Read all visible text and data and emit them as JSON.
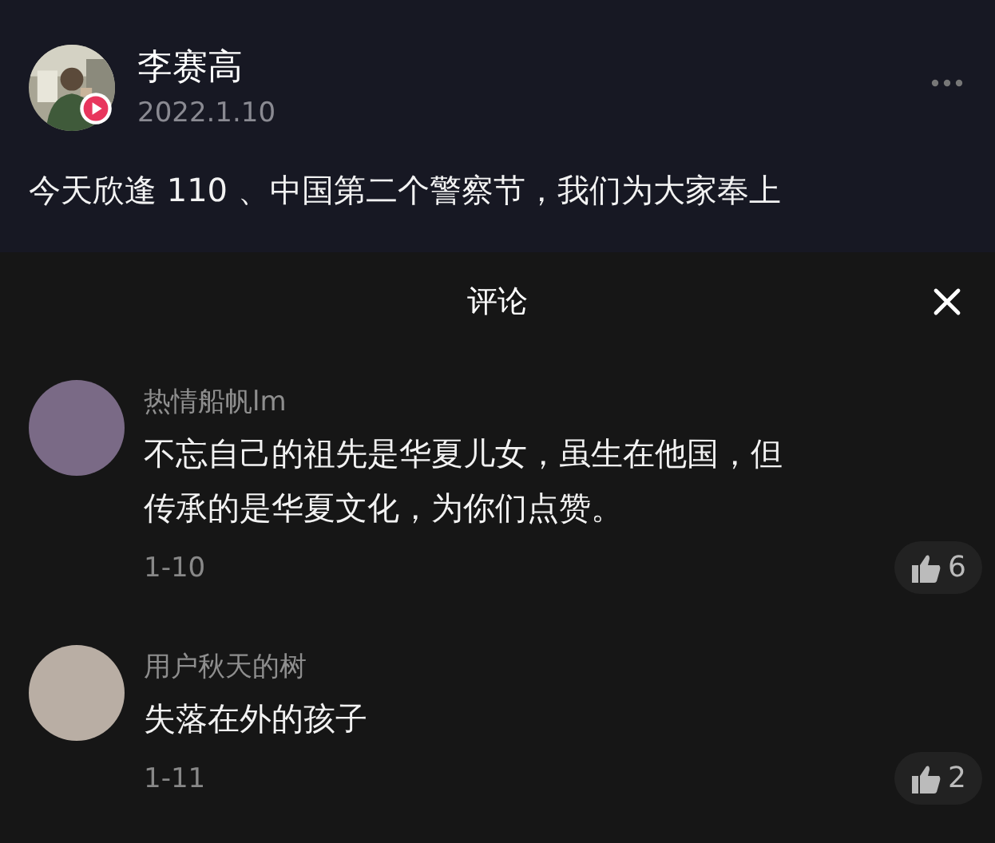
{
  "post": {
    "author": "李赛高",
    "date": "2022.1.10",
    "text": "今天欣逢 110 、中国第二个警察节，我们为大家奉上"
  },
  "comments_sheet": {
    "title": "评论",
    "comments": [
      {
        "user": "热情船帆lm",
        "color": "#7a6a86",
        "text": "不忘自己的祖先是华夏儿女，虽生在他国，但传承的是华夏文化，为你们点赞。",
        "date": "1-10",
        "likes": "6"
      },
      {
        "user": "用户秋天的树",
        "color": "#b9aea4",
        "text": "失落在外的孩子",
        "date": "1-11",
        "likes": "2"
      }
    ]
  }
}
